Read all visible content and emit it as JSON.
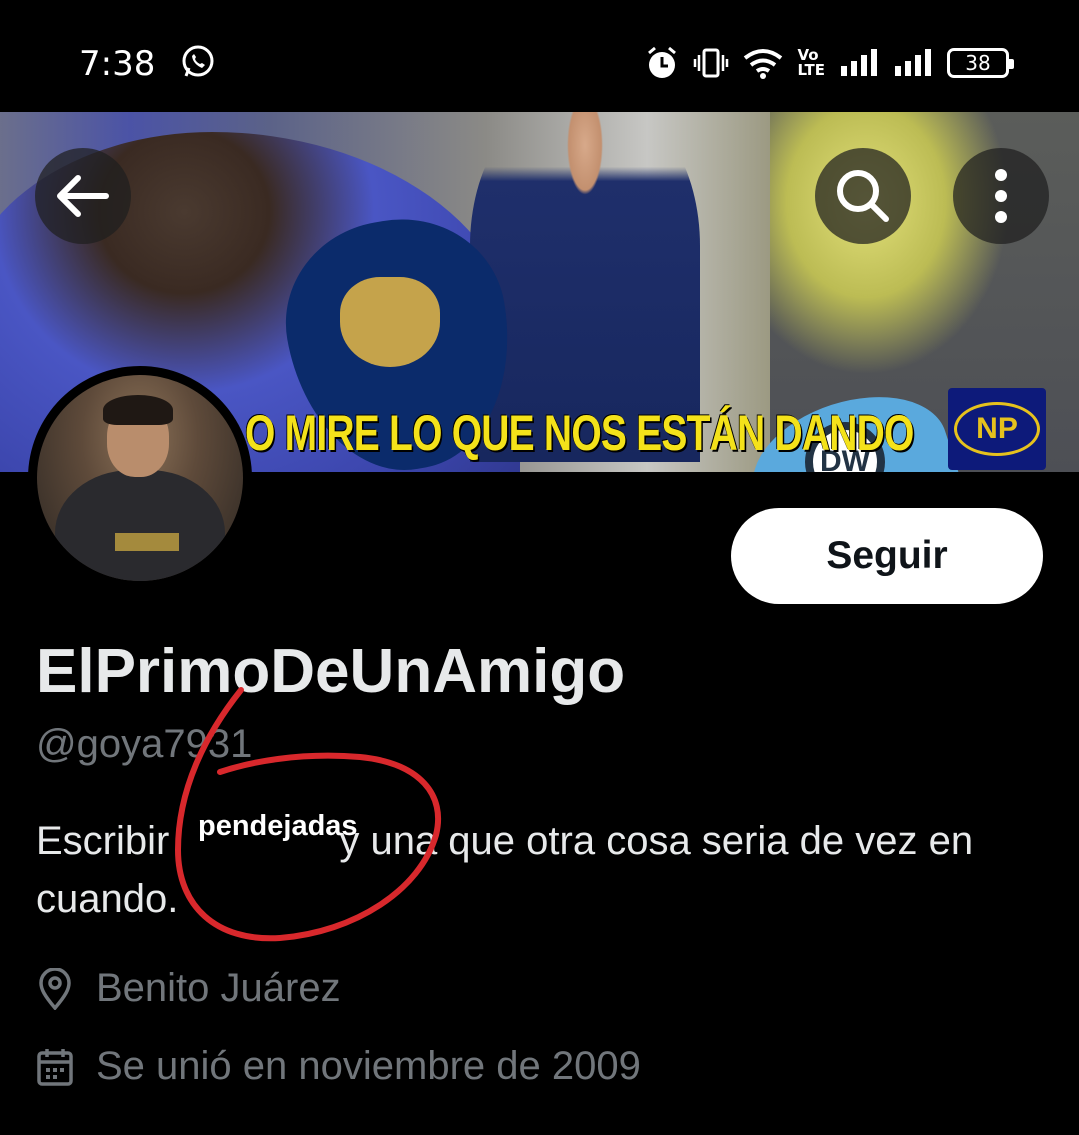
{
  "status_bar": {
    "time": "7:38",
    "signal_tag": "Vo\nLTE",
    "battery": "38"
  },
  "header": {
    "banner_caption": "O MIRE LO QUE NOS ESTÁN DANDO",
    "banner_badge": "NP",
    "mic_logo": "DW"
  },
  "profile": {
    "display_name": "ElPrimoDeUnAmigo",
    "handle": "@goya7931",
    "bio_start": "Escribir",
    "bio_end": "y una que otra cosa seria de vez en cuando.",
    "location": "Benito Juárez",
    "joined": "Se unió en noviembre de 2009",
    "follow_label": "Seguir"
  },
  "annotation": {
    "handwritten_word": "pendejadas",
    "color": "#d8282c"
  },
  "colors": {
    "background": "#000000",
    "primary_text": "#e7e9ea",
    "secondary_text": "#71767b",
    "follow_button_bg": "#ffffff"
  }
}
